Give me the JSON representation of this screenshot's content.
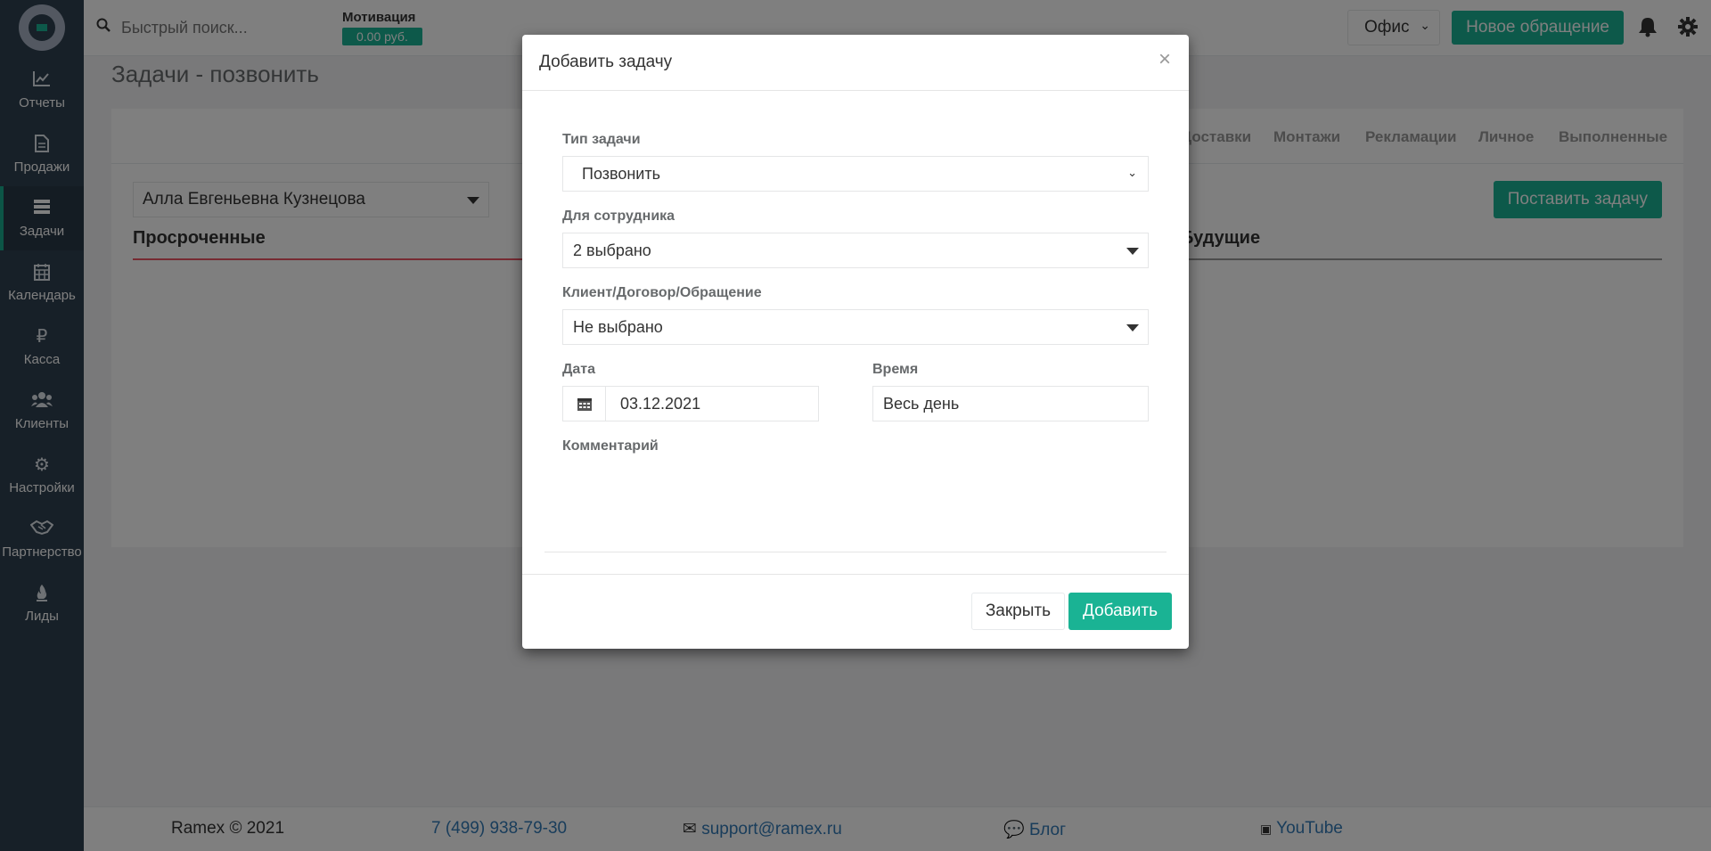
{
  "sidebar": {
    "items": [
      {
        "label": "Отчеты",
        "icon": "chart-line-icon"
      },
      {
        "label": "Продажи",
        "icon": "document-icon"
      },
      {
        "label": "Задачи",
        "icon": "tasks-icon",
        "active": true
      },
      {
        "label": "Календарь",
        "icon": "calendar-icon"
      },
      {
        "label": "Касса",
        "icon": "ruble-icon"
      },
      {
        "label": "Клиенты",
        "icon": "users-icon"
      },
      {
        "label": "Настройки",
        "icon": "gear-icon"
      },
      {
        "label": "Партнерство",
        "icon": "handshake-icon"
      },
      {
        "label": "Лиды",
        "icon": "fire-icon"
      }
    ]
  },
  "topbar": {
    "search_placeholder": "Быстрый поиск...",
    "motivation_label": "Мотивация",
    "motivation_value": "0.00 руб.",
    "office": "Офис",
    "new_request": "Новое обращение"
  },
  "page": {
    "title": "Задачи - позвонить",
    "tabs": [
      "Доставки",
      "Монтажи",
      "Рекламации",
      "Личное",
      "Выполненные"
    ],
    "employee": "Алла Евгеньевна Кузнецова",
    "set_task": "Поставить задачу",
    "overdue_title": "Просроченные",
    "future_title": "Будущие"
  },
  "footer": {
    "copyright": "Ramex © 2021",
    "phone": "7 (499) 938-79-30",
    "email": "support@ramex.ru",
    "blog": "Блог",
    "youtube": "YouTube"
  },
  "modal": {
    "title": "Добавить задачу",
    "close_symbol": "×",
    "task_type_label": "Тип задачи",
    "task_type_value": "Позвонить",
    "employee_label": "Для сотрудника",
    "employee_value": "2 выбрано",
    "client_label": "Клиент/Договор/Обращение",
    "client_value": "Не выбрано",
    "date_label": "Дата",
    "date_value": "03.12.2021",
    "time_label": "Время",
    "time_value": "Весь день",
    "comment_label": "Комментарий",
    "close_button": "Закрыть",
    "add_button": "Добавить"
  },
  "colors": {
    "accent": "#1ab394",
    "sidebar": "#2f4050",
    "overdue": "#ed5565"
  }
}
